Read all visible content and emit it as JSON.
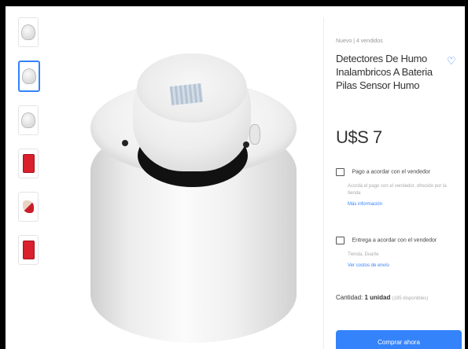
{
  "product": {
    "condition": "Nuevo | 4 vendidos",
    "title": "Detectores De Humo Inalambricos A Bateria Pilas Sensor Humo",
    "price": "U$S 7"
  },
  "payment": {
    "label": "Pago a acordar con el vendedor",
    "detail": "Acordá el pago con el vendedor, ofrecido por la tienda",
    "link": "Más información"
  },
  "delivery": {
    "label": "Entrega a acordar con el vendedor",
    "location": "Tienda, Duarte",
    "link": "Ver costos de envío"
  },
  "quantity": {
    "label": "Cantidad:",
    "value": "1 unidad",
    "available": "(185 disponibles)"
  },
  "actions": {
    "buy_label": "Comprar ahora"
  },
  "thumbnails": [
    {
      "icon": "white-detector-icon"
    },
    {
      "icon": "white-detector-icon",
      "selected": true
    },
    {
      "icon": "white-detector-icon"
    },
    {
      "icon": "red-alarm-icon"
    },
    {
      "icon": "hand-alarm-icon"
    },
    {
      "icon": "red-alarm-icon"
    }
  ],
  "colors": {
    "accent": "#3483fa",
    "text": "#333333",
    "muted": "#999999"
  }
}
